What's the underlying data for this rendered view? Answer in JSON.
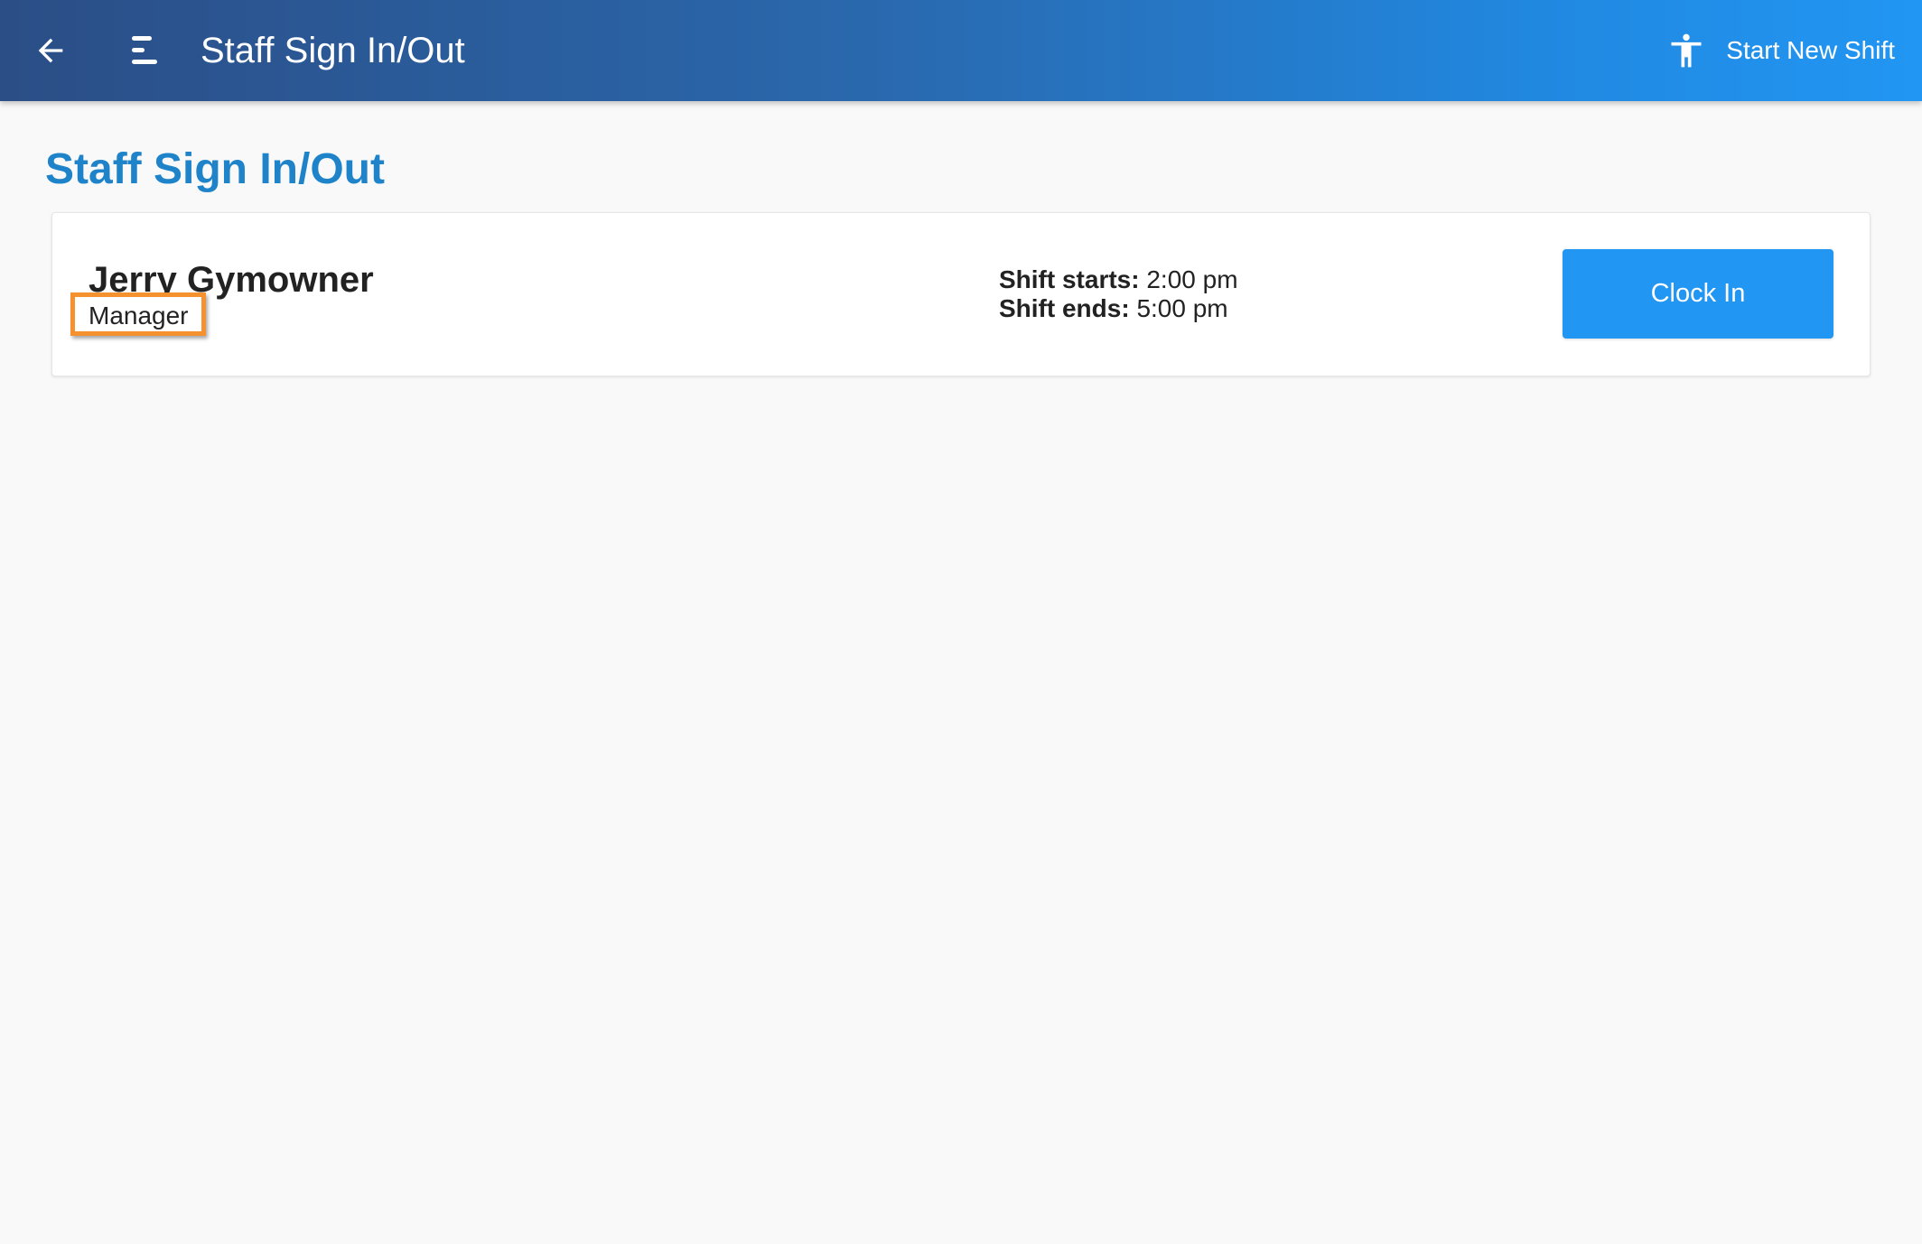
{
  "app_bar": {
    "title": "Staff Sign In/Out",
    "back_icon": "arrow-left-icon",
    "menu_icon": "menu-icon",
    "start_shift_icon": "accessibility-person-icon",
    "start_shift_label": "Start New Shift",
    "gradient_colors": [
      "#2b4e86",
      "#2196f3"
    ]
  },
  "page": {
    "heading": "Staff Sign In/Out",
    "heading_color": "#1f83c9"
  },
  "staff": [
    {
      "name": "Jerry Gymowner",
      "role": "Manager",
      "shift_starts_label": "Shift starts:",
      "shift_starts_value": "2:00 pm",
      "shift_ends_label": "Shift ends:",
      "shift_ends_value": "5:00 pm",
      "action_label": "Clock In",
      "action_color": "#2196f3",
      "highlight_color": "#f5922f"
    }
  ]
}
